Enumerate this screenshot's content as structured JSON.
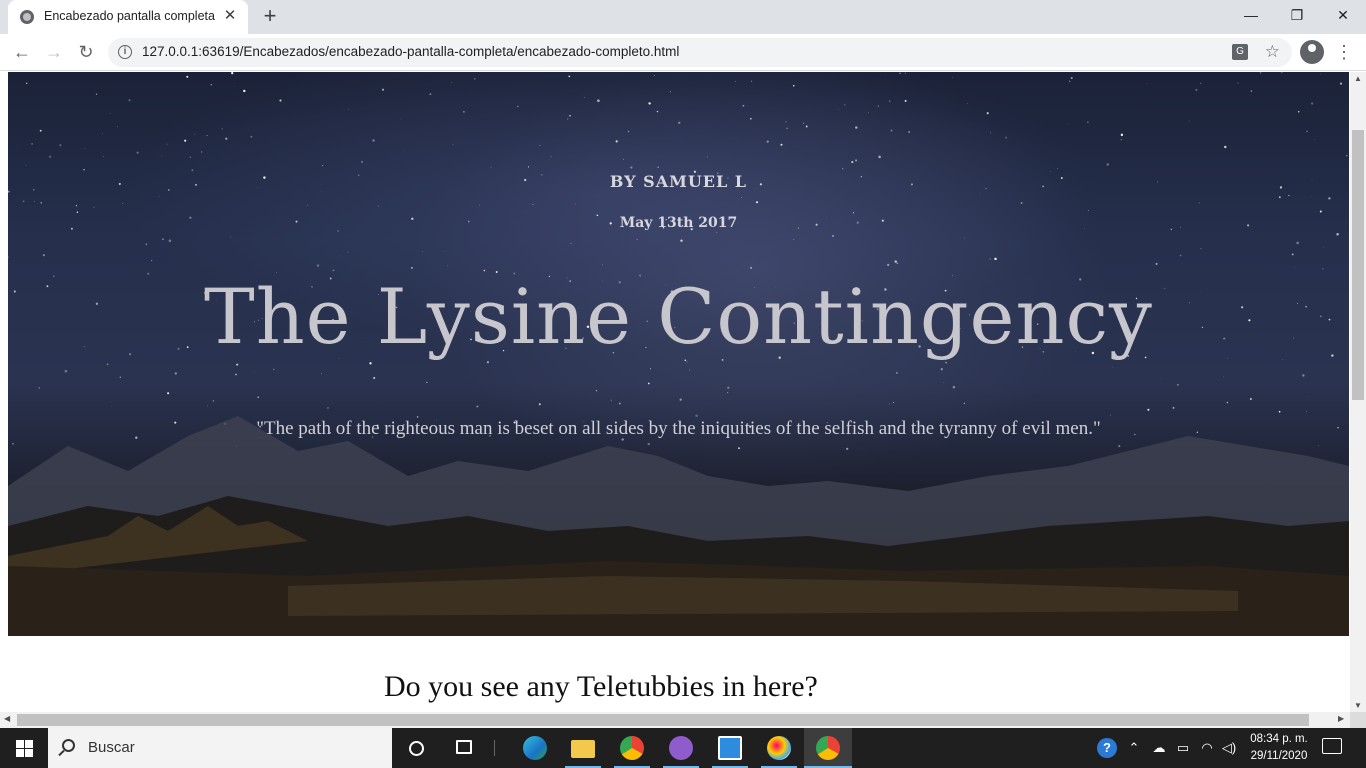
{
  "browser": {
    "tab_title": "Encabezado pantalla completa",
    "tab_close": "✕",
    "new_tab": "+",
    "url": "127.0.0.1:63619/Encabezados/encabezado-pantalla-completa/encabezado-completo.html",
    "window_controls": {
      "minimize": "—",
      "restore": "❐",
      "close": "✕"
    },
    "nav": {
      "back": "←",
      "forward": "→",
      "reload": "↻",
      "star": "☆",
      "menu": "⋮",
      "info": "i",
      "translate": "G"
    }
  },
  "page": {
    "byline": "BY SAMUEL L",
    "date": "May 13th 2017",
    "headline": "The Lysine Contingency",
    "quote": "\"The path of the righteous man is beset on all sides by the iniquities of the selfish and the tyranny of evil men.\"",
    "subheading": "Do you see any Teletubbies in here?"
  },
  "taskbar": {
    "search_placeholder": "Buscar",
    "apps": [
      {
        "name": "cortana-icon"
      },
      {
        "name": "task-view-icon"
      },
      {
        "name": "edge-icon"
      },
      {
        "name": "file-explorer-icon"
      },
      {
        "name": "chrome-icon"
      },
      {
        "name": "github-desktop-icon"
      },
      {
        "name": "remote-app-icon"
      },
      {
        "name": "paint-icon"
      },
      {
        "name": "chrome-active-icon"
      }
    ],
    "clock_time": "08:34 p. m.",
    "clock_date": "29/11/2020"
  },
  "colors": {
    "accent": "#76b9ed",
    "hero_text": "#c6c6cc",
    "chrome_frame": "#dee1e6"
  }
}
